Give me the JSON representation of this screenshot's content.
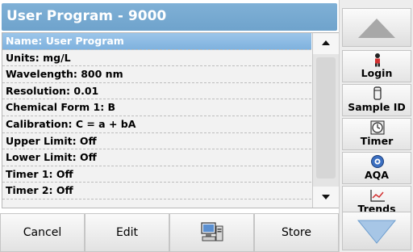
{
  "header": {
    "title": "User Program - 9000"
  },
  "list": {
    "items": [
      "Name: User Program",
      "Units: mg/L",
      "Wavelength: 800 nm",
      "Resolution: 0.01",
      "Chemical Form 1: B",
      "Calibration: C = a + bA",
      "Upper Limit: Off",
      "Lower Limit: Off",
      "Timer 1: Off",
      "Timer 2: Off"
    ],
    "selected_index": 0
  },
  "bottom": {
    "cancel": "Cancel",
    "edit": "Edit",
    "store": "Store"
  },
  "side": {
    "login": "Login",
    "sample_id": "Sample ID",
    "timer": "Timer",
    "aqa": "AQA",
    "trends": "Trends"
  },
  "colors": {
    "title_bar": "#6fa3cc",
    "selection": "#8cbce4",
    "icon_blue": "#3b6fc1",
    "nav_arrow": "#a7c6e6"
  }
}
